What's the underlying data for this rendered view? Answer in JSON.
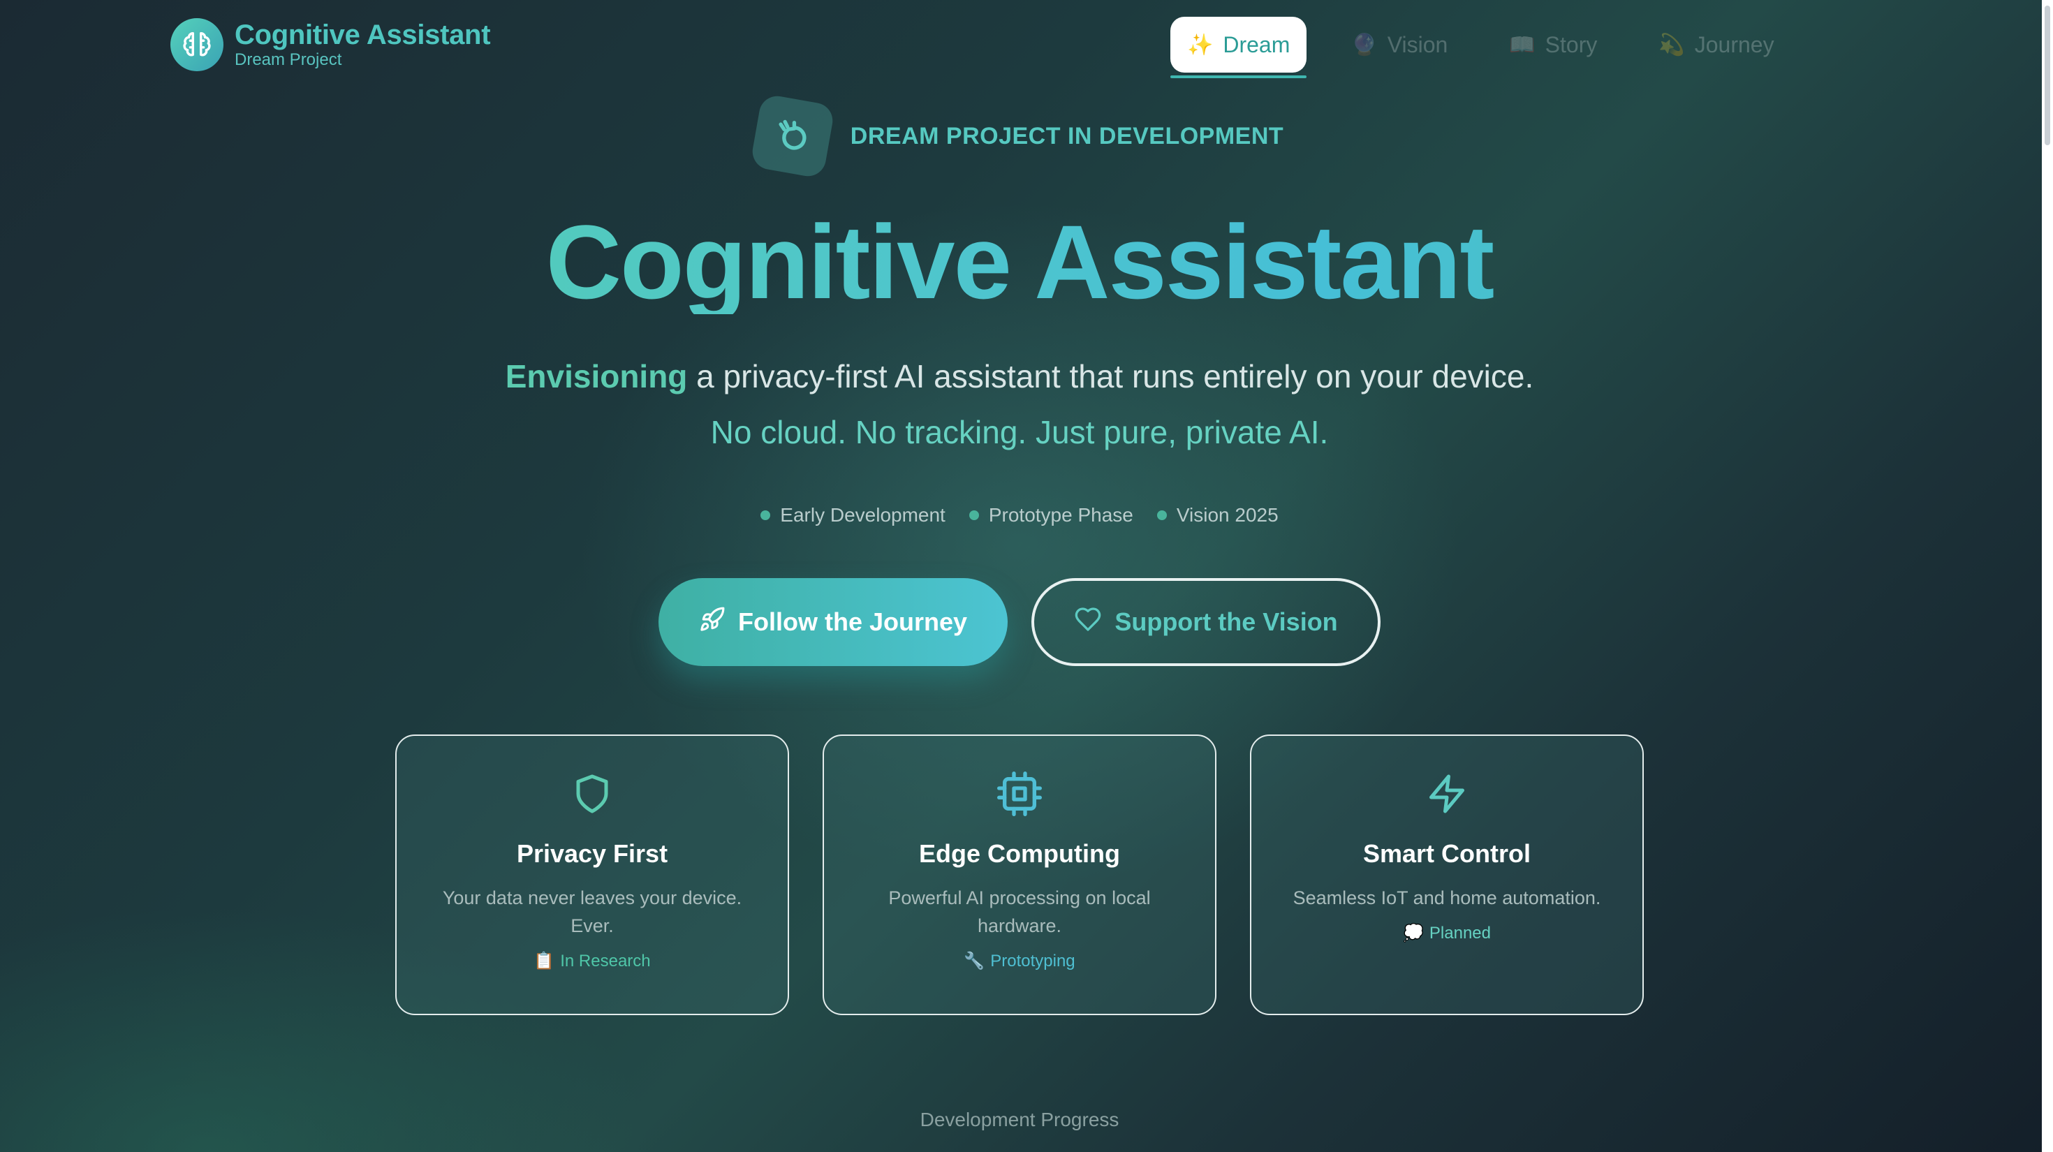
{
  "header": {
    "title": "Cognitive Assistant",
    "subtitle": "Dream Project",
    "logo_icon": "brain-icon"
  },
  "nav": [
    {
      "label": "Dream",
      "glyph": "✨",
      "active": true
    },
    {
      "label": "Vision",
      "glyph": "🔮",
      "active": false
    },
    {
      "label": "Story",
      "glyph": "📖",
      "active": false
    },
    {
      "label": "Journey",
      "glyph": "💫",
      "active": false
    }
  ],
  "hero": {
    "badge": "DREAM PROJECT IN DEVELOPMENT",
    "title": "Cognitive Assistant",
    "tagline_accent": "Envisioning",
    "tagline_rest": " a privacy-first AI assistant that runs entirely on your device.",
    "tagline_2": "No cloud. No tracking. Just pure, private AI.",
    "stages": [
      "Early Development",
      "Prototype Phase",
      "Vision 2025"
    ],
    "cta_primary": "Follow the Journey",
    "cta_secondary": "Support the Vision"
  },
  "cards": [
    {
      "title": "Privacy First",
      "desc": "Your data never leaves your device. Ever.",
      "status_glyph": "📋",
      "status": "In Research",
      "icon": "shield-icon"
    },
    {
      "title": "Edge Computing",
      "desc": "Powerful AI processing on local hardware.",
      "status_glyph": "🔧",
      "status": "Prototyping",
      "icon": "cpu-icon"
    },
    {
      "title": "Smart Control",
      "desc": "Seamless IoT and home automation.",
      "status_glyph": "💭",
      "status": "Planned",
      "icon": "lightning-icon"
    }
  ],
  "footer": {
    "progress_label": "Development Progress"
  },
  "colors": {
    "accent": "#4fc6c0",
    "accent_green": "#56cfa9",
    "accent_blue": "#46bfd6"
  }
}
